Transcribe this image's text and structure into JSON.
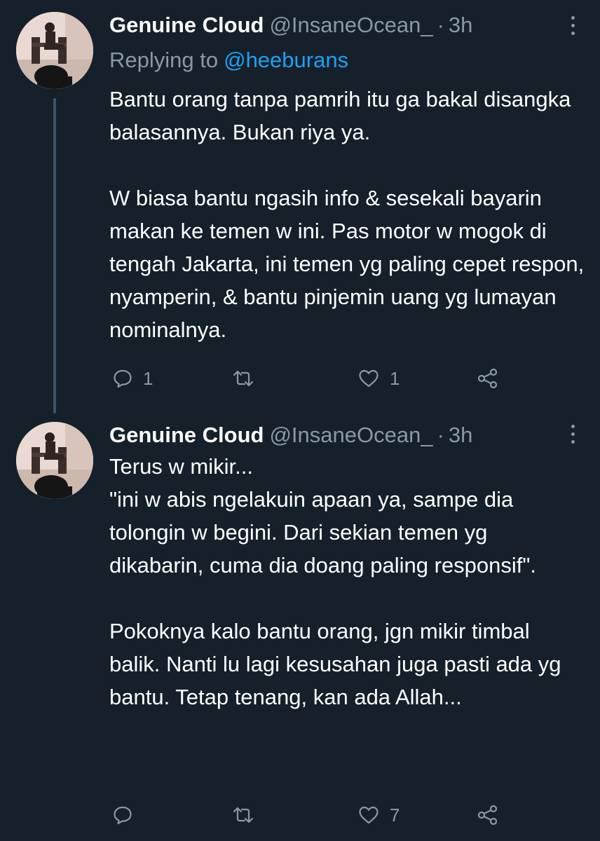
{
  "tweets": [
    {
      "author_name": "Genuine Cloud",
      "handle": "@InsaneOcean_",
      "separator": "·",
      "time": "3h",
      "replying_label": "Replying to",
      "replying_to": "@heeburans",
      "paragraphs": [
        "Bantu orang tanpa pamrih itu ga bakal disangka balasannya. Bukan riya ya.",
        "W biasa bantu ngasih info & sesekali bayarin makan ke temen w ini. Pas motor w mogok di tengah Jakarta, ini temen yg paling cepet respon, nyamperin, & bantu pinjemin uang yg lumayan nominalnya."
      ],
      "reply_count": "1",
      "retweet_count": "",
      "like_count": "1",
      "icons": [
        "reply-icon",
        "retweet-icon",
        "like-icon",
        "share-icon",
        "more-icon"
      ]
    },
    {
      "author_name": "Genuine Cloud",
      "handle": "@InsaneOcean_",
      "separator": "·",
      "time": "3h",
      "paragraphs": [
        "Terus w mikir...",
        "\"ini w abis ngelakuin apaan ya, sampe dia tolongin w begini. Dari sekian temen yg dikabarin, cuma dia doang paling responsif\".",
        "Pokoknya kalo bantu orang, jgn mikir timbal balik. Nanti lu lagi kesusahan juga pasti ada yg bantu. Tetap tenang, kan ada Allah..."
      ],
      "reply_count": "",
      "retweet_count": "",
      "like_count": "7",
      "icons": [
        "reply-icon",
        "retweet-icon",
        "like-icon",
        "share-icon",
        "more-icon"
      ]
    }
  ],
  "colors": {
    "background": "#15202b",
    "text": "#ffffff",
    "secondary": "#8899a6",
    "link": "#1da1f2",
    "thread_line": "#3d5466"
  }
}
